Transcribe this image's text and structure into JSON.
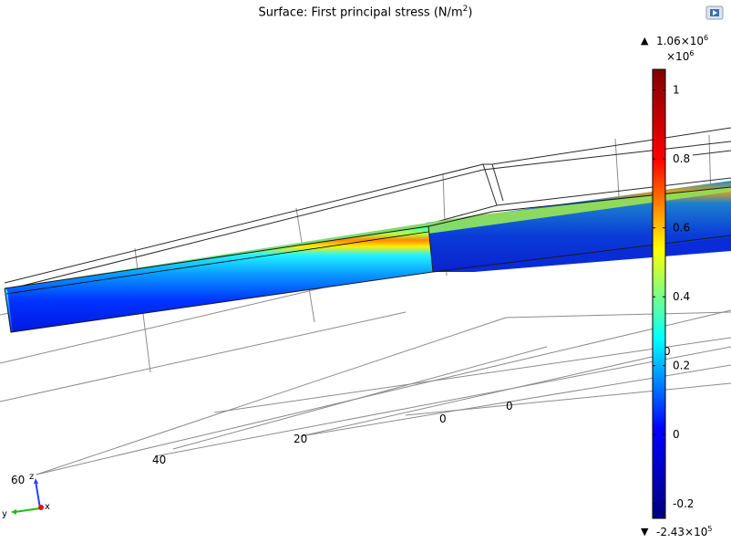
{
  "title": {
    "prefix": "Surface: First principal stress (N/m",
    "sup": "2",
    "suffix": ")"
  },
  "icons": {
    "corner": "image-snapshot-icon",
    "axis_triad": "axis-triad-icon"
  },
  "axes_ticks": {
    "near_x": [
      "40",
      "20",
      "0"
    ],
    "left_y": [
      "60"
    ],
    "far": [
      "0",
      "0"
    ]
  },
  "triad": {
    "z": "z",
    "y": "y",
    "x": "x"
  },
  "colorbar": {
    "max_label": {
      "mantissa": "1.06×10",
      "exp": "6"
    },
    "scale_label": {
      "base": "×10",
      "exp": "6"
    },
    "min_label": {
      "mantissa": "-2.43×10",
      "exp": "5"
    },
    "max_marker": "▲",
    "min_marker": "▼"
  },
  "chart_data": {
    "type": "heatmap",
    "title": "Surface: First principal stress (N/m2)",
    "colormap": "Rainbow",
    "colors": [
      "#00007f",
      "#0000ff",
      "#00ffff",
      "#ffff00",
      "#ff0000",
      "#7f0000"
    ],
    "range": {
      "min": -243000,
      "max": 1060000,
      "unit": "N/m^2"
    },
    "colorbar_ticks": [
      -0.2,
      0,
      0.2,
      0.4,
      0.6,
      0.8,
      1
    ],
    "colorbar_tick_labels": [
      "-0.2",
      "0",
      "0.2",
      "0.4",
      "0.6",
      "0.8",
      "1"
    ],
    "colorbar_multiplier": "×10^6"
  }
}
